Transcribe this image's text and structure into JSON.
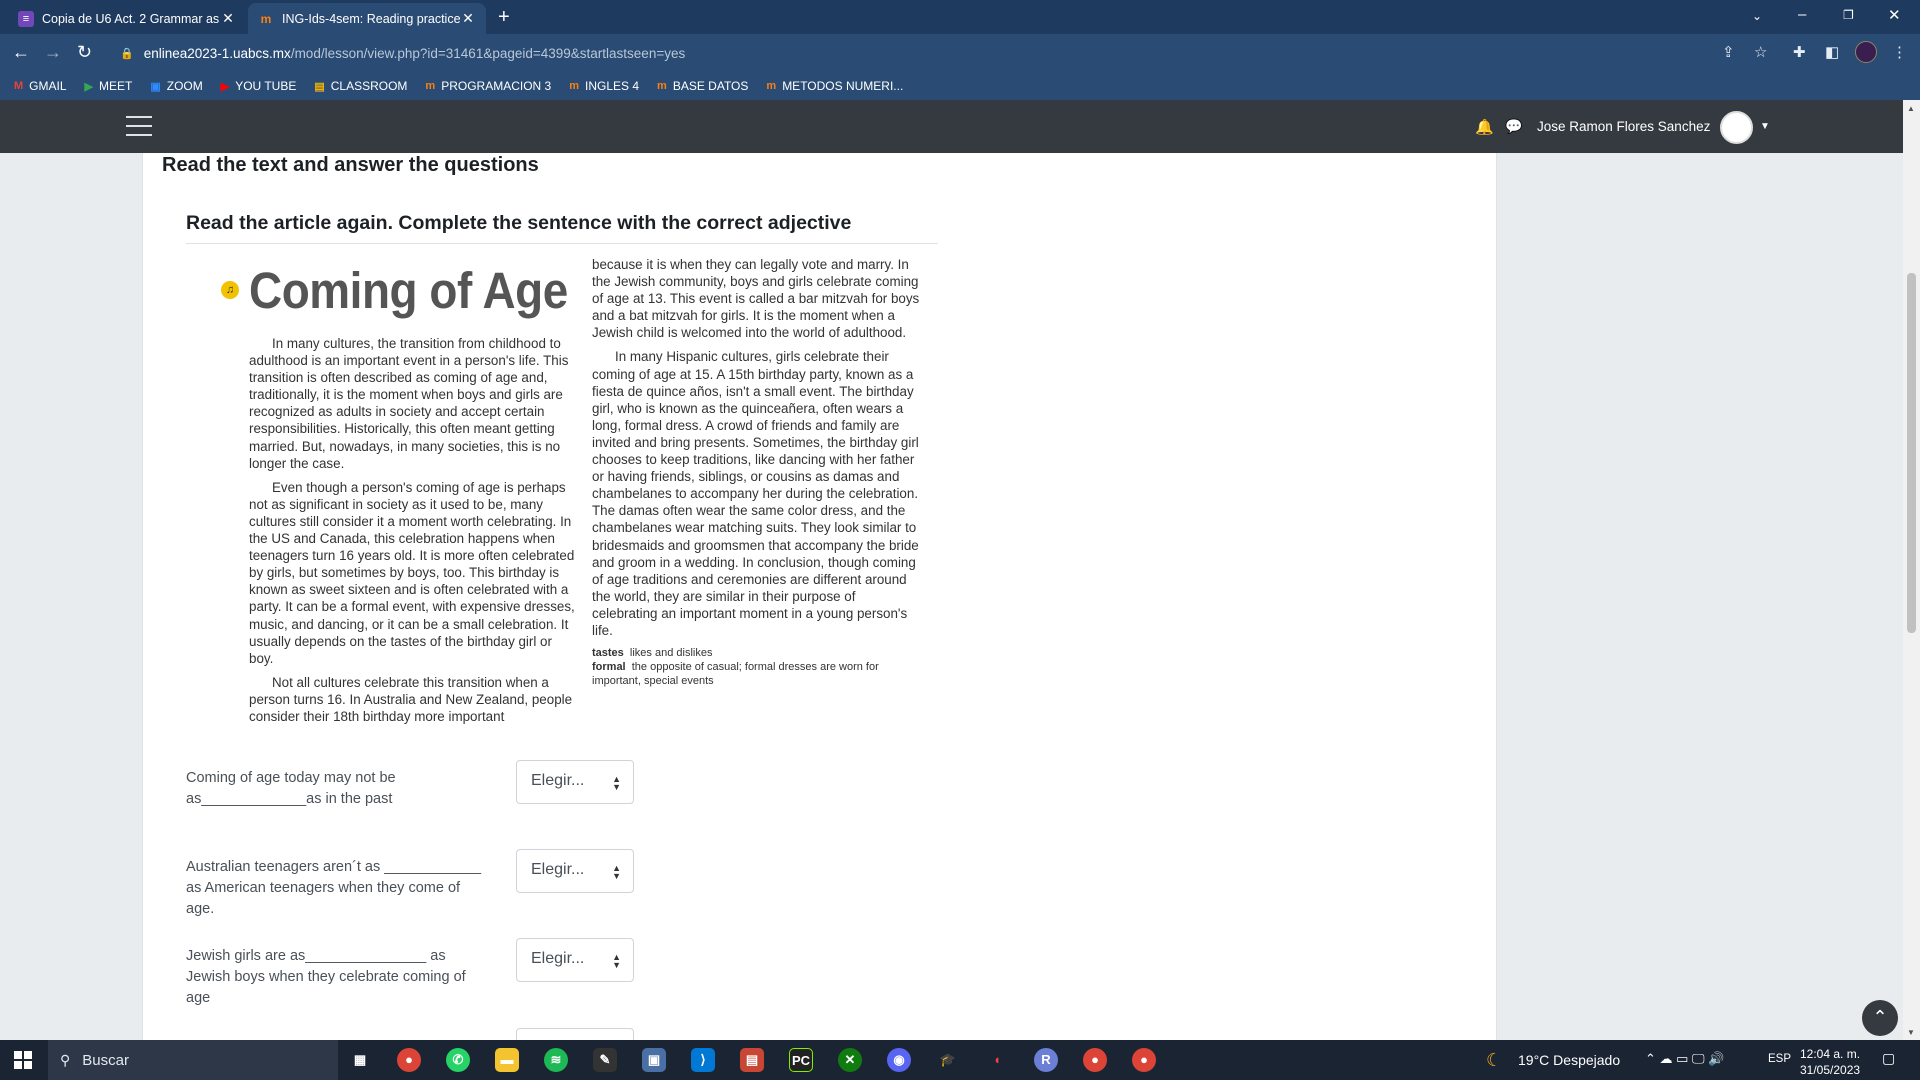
{
  "browser": {
    "tabs": [
      {
        "title": "Copia de U6 Act. 2 Grammar as...",
        "favicon": "sheets-icon"
      },
      {
        "title": "ING-Ids-4sem: Reading practice",
        "favicon": "moodle-icon"
      }
    ],
    "url_host": "enlinea2023-1.uabcs.mx",
    "url_path": "/mod/lesson/view.php?id=31461&pageid=4399&startlastseen=yes",
    "bookmarks": [
      {
        "label": "GMAIL",
        "icon": "M",
        "color": "#ea4335"
      },
      {
        "label": "MEET",
        "icon": "▶",
        "color": "#34a853"
      },
      {
        "label": "ZOOM",
        "icon": "▣",
        "color": "#2d8cff"
      },
      {
        "label": "YOU TUBE",
        "icon": "▶",
        "color": "#ff0000"
      },
      {
        "label": "CLASSROOM",
        "icon": "▤",
        "color": "#f4b400"
      },
      {
        "label": "PROGRAMACION 3",
        "icon": "m",
        "color": "#f98012"
      },
      {
        "label": "INGLES 4",
        "icon": "m",
        "color": "#f98012"
      },
      {
        "label": "BASE DATOS",
        "icon": "m",
        "color": "#f98012"
      },
      {
        "label": "METODOS NUMERI...",
        "icon": "m",
        "color": "#f98012"
      }
    ]
  },
  "navbar": {
    "username": "Jose Ramon Flores Sanchez"
  },
  "page": {
    "heading": "Read the text and answer the questions",
    "subheading": "Read the article again. Complete the sentence with the correct adjective"
  },
  "article": {
    "title": "Coming of Age",
    "col1_p1": "In many cultures, the transition from childhood to adulthood is an important event in a person's life. This transition is often described as coming of age and, traditionally, it is the moment when boys and girls are recognized as adults in society and accept certain responsibilities. Historically, this often meant getting married. But, nowadays, in many societies, this is no longer the case.",
    "col1_p2": "Even though a person's coming of age is perhaps not as significant in society as it used to be, many cultures still consider it a moment worth celebrating. In the US and Canada, this celebration happens when teenagers turn 16 years old. It is more often celebrated by girls, but sometimes by boys, too. This birthday is known as sweet sixteen and is often celebrated with a party. It can be a formal event, with expensive dresses, music, and dancing, or it can be a small celebration. It usually depends on the tastes of the birthday girl or boy.",
    "col1_p3": "Not all cultures celebrate this transition when a person turns 16. In Australia and New Zealand, people consider their 18th birthday more important",
    "col2_p1": "because it is when they can legally vote and marry. In the Jewish community, boys and girls celebrate coming of age at 13. This event is called a bar mitzvah for boys and a bat mitzvah for girls. It is the moment when a Jewish child is welcomed into the world of adulthood.",
    "col2_p2": "In many Hispanic cultures, girls celebrate their coming of age at 15. A 15th birthday party, known as a fiesta de quince años, isn't a small event. The birthday girl, who is known as the quinceañera, often wears a long, formal dress. A crowd of friends and family are invited and bring presents. Sometimes, the birthday girl chooses to keep traditions, like dancing with her father or having friends, siblings, or cousins as damas and chambelanes to accompany her during the celebration. The damas often wear the same color dress, and the chambelanes wear matching suits. They look similar to bridesmaids and groomsmen that accompany the bride and groom in a wedding. In conclusion, though coming of age traditions and ceremonies are different around the world, they are similar in their purpose of celebrating an important moment in a young person's life.",
    "gloss_tastes_term": "tastes",
    "gloss_tastes_def": "likes and dislikes",
    "gloss_formal_term": "formal",
    "gloss_formal_def": "the opposite of casual; formal dresses are worn for important, special events"
  },
  "questions": [
    {
      "text": "Coming of age today may not be as_____________as in the past",
      "selected": "Elegir..."
    },
    {
      "text": "Australian teenagers aren´t as ____________ as American teenagers when they come of age.",
      "selected": "Elegir..."
    },
    {
      "text": "Jewish girls are as_______________ as Jewish boys when they celebrate coming of age",
      "selected": "Elegir..."
    }
  ],
  "taskbar": {
    "search_placeholder": "Buscar",
    "weather": "19°C  Despejado",
    "lang": "ESP",
    "time": "12:04 a. m.",
    "date": "31/05/2023"
  }
}
